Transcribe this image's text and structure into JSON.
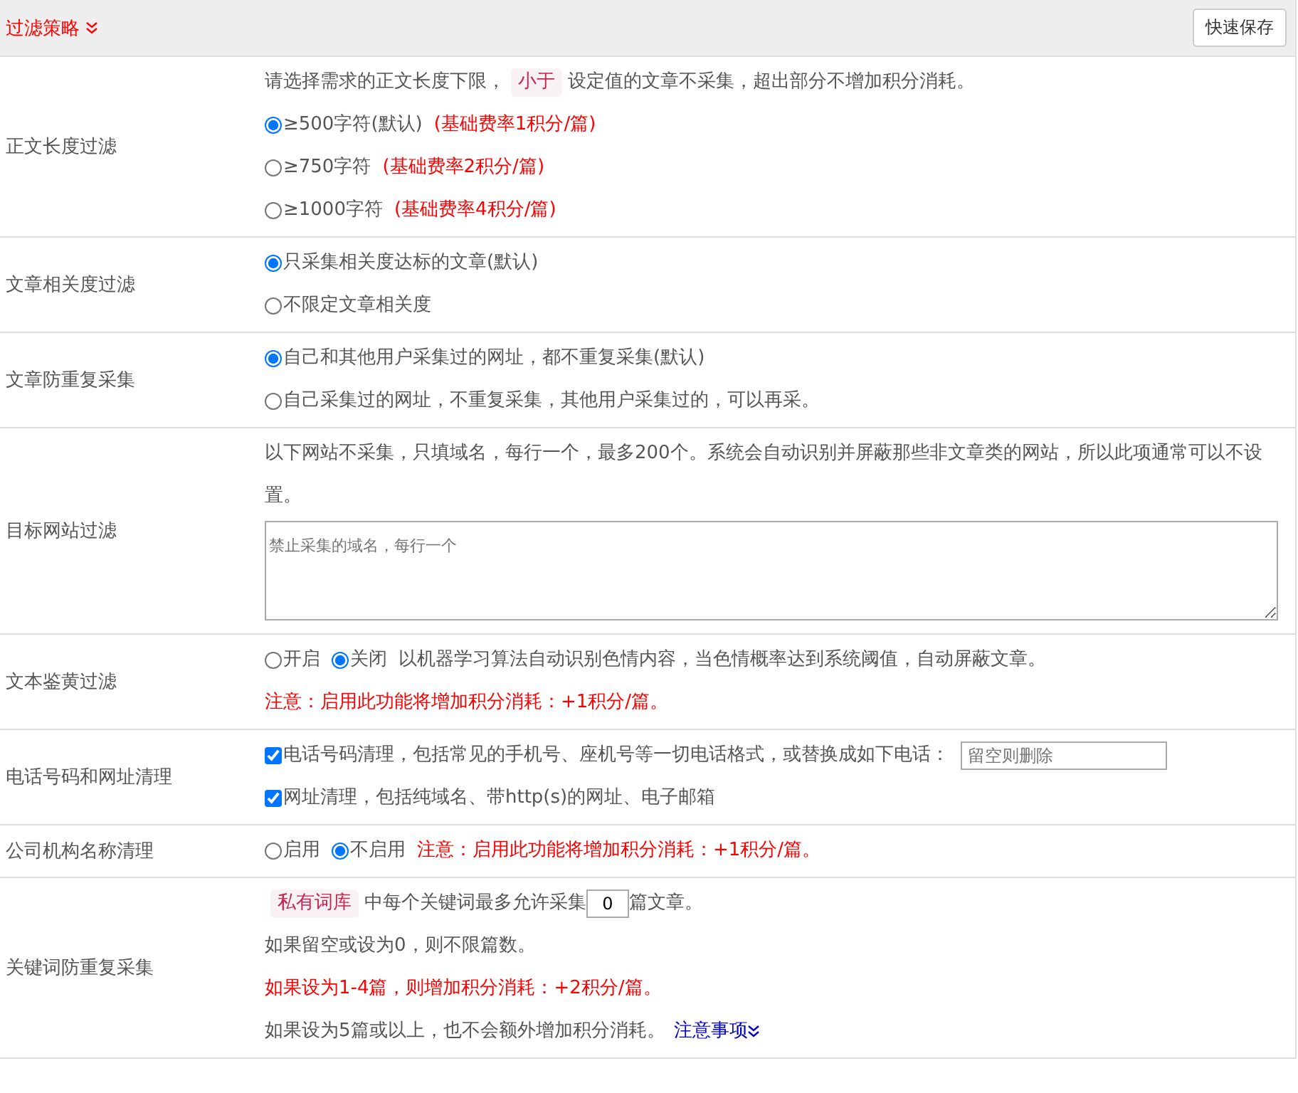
{
  "panel": {
    "title": "过滤策略",
    "save_button": "快速保存"
  },
  "rows": [
    {
      "label": "正文长度过滤",
      "lines": [
        [
          {
            "kind": "text",
            "text": "请选择需求的正文长度下限，"
          },
          {
            "kind": "tag",
            "text": "小于"
          },
          {
            "kind": "text",
            "text": "设定值的文章不采集，超出部分不增加积分消耗。"
          }
        ],
        [
          {
            "kind": "radio",
            "text": "≥500字符(默认)",
            "selected": true
          },
          {
            "kind": "note",
            "text": "(基础费率1积分/篇)"
          }
        ],
        [
          {
            "kind": "radio",
            "text": "≥750字符",
            "selected": false
          },
          {
            "kind": "note",
            "text": "(基础费率2积分/篇)"
          }
        ],
        [
          {
            "kind": "radio",
            "text": "≥1000字符",
            "selected": false
          },
          {
            "kind": "note",
            "text": "(基础费率4积分/篇)"
          }
        ]
      ]
    },
    {
      "label": "文章相关度过滤",
      "lines": [
        [
          {
            "kind": "radio",
            "text": "只采集相关度达标的文章(默认)",
            "selected": true
          }
        ],
        [
          {
            "kind": "radio",
            "text": "不限定文章相关度",
            "selected": false
          }
        ]
      ]
    },
    {
      "label": "文章防重复采集",
      "lines": [
        [
          {
            "kind": "radio",
            "text": "自己和其他用户采集过的网址，都不重复采集(默认)",
            "selected": true
          }
        ],
        [
          {
            "kind": "radio",
            "text": "自己采集过的网址，不重复采集，其他用户采集过的，可以再采。",
            "selected": false
          }
        ]
      ]
    },
    {
      "label": "目标网站过滤",
      "lines": [
        [
          {
            "kind": "text",
            "text": "以下网站不采集，只填域名，每行一个，最多200个。系统会自动识别并屏蔽那些非文章类的网站，所以此项通常可以不设置。"
          }
        ],
        [
          {
            "kind": "textarea",
            "placeholder": "禁止采集的域名，每行一个"
          }
        ]
      ]
    },
    {
      "label": "文本鉴黄过滤",
      "lines": [
        [
          {
            "kind": "radio",
            "text": "开启",
            "selected": false
          },
          {
            "kind": "radio",
            "text": "关闭",
            "selected": true
          },
          {
            "kind": "text",
            "text": "以机器学习算法自动识别色情内容，当色情概率达到系统阈值，自动屏蔽文章。"
          }
        ],
        [
          {
            "kind": "note",
            "text": "注意：启用此功能将增加积分消耗：+1积分/篇。"
          }
        ]
      ]
    },
    {
      "label": "电话号码和网址清理",
      "lines": [
        [
          {
            "kind": "checkbox",
            "text": "电话号码清理，包括常见的手机号、座机号等一切电话格式，或替换成如下电话：",
            "checked": true
          },
          {
            "kind": "input",
            "placeholder": "留空则删除"
          }
        ],
        [
          {
            "kind": "checkbox",
            "text": "网址清理，包括纯域名、带http(s)的网址、电子邮箱",
            "checked": true
          }
        ]
      ]
    },
    {
      "label": "公司机构名称清理",
      "lines": [
        [
          {
            "kind": "radio",
            "text": "启用",
            "selected": false
          },
          {
            "kind": "radio",
            "text": "不启用",
            "selected": true
          },
          {
            "kind": "note",
            "text": "注意：启用此功能将增加积分消耗：+1积分/篇。"
          }
        ]
      ]
    },
    {
      "label": "关键词防重复采集",
      "lines": [
        [
          {
            "kind": "tag",
            "text": "私有词库"
          },
          {
            "kind": "text",
            "text": "中每个关键词最多允许采集"
          },
          {
            "kind": "input",
            "value": "0"
          },
          {
            "kind": "text",
            "text": "篇文章。"
          }
        ],
        [
          {
            "kind": "text",
            "text": "如果留空或设为0，则不限篇数。"
          }
        ],
        [
          {
            "kind": "note",
            "text": "如果设为1-4篇，则增加积分消耗：+2积分/篇。"
          }
        ],
        [
          {
            "kind": "text",
            "text": "如果设为5篇或以上，也不会额外增加积分消耗。"
          },
          {
            "kind": "link",
            "text": "注意事项"
          }
        ]
      ]
    }
  ]
}
